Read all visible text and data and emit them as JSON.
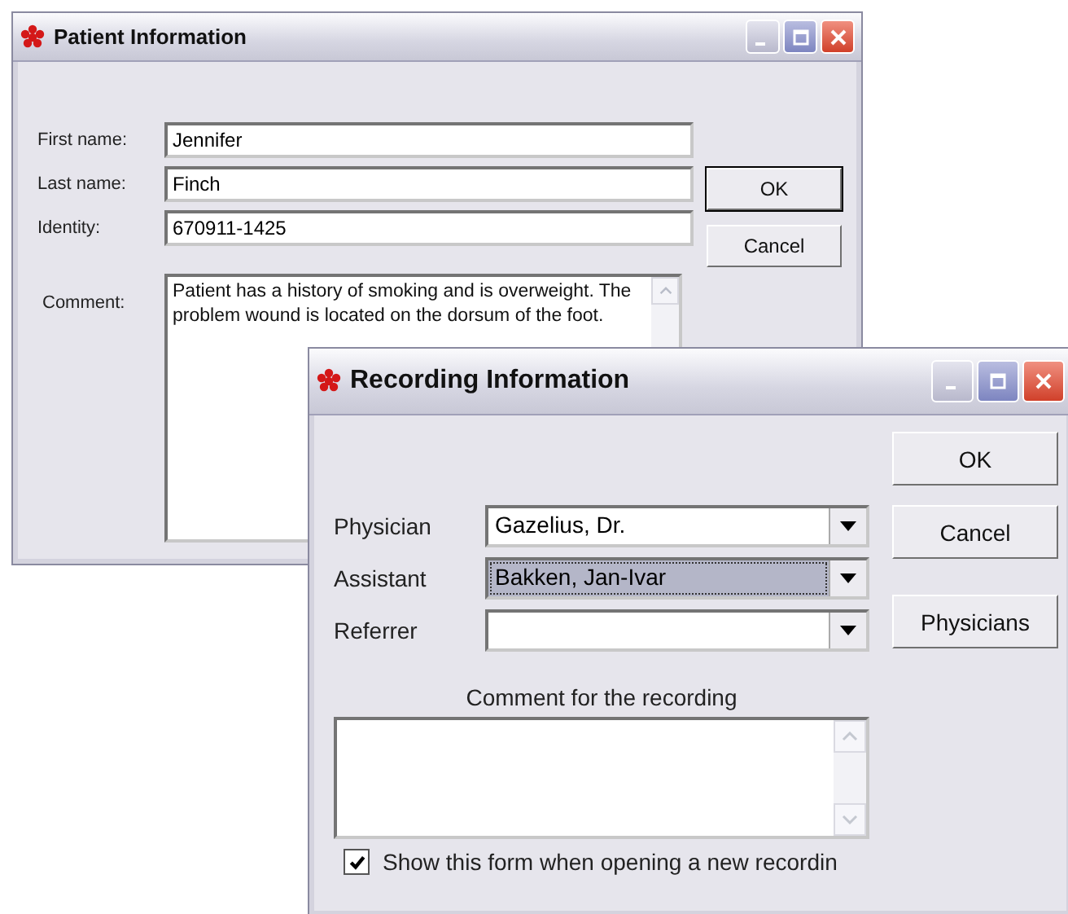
{
  "patient_window": {
    "title": "Patient Information",
    "fields": [
      {
        "label": "First name:",
        "value": "Jennifer"
      },
      {
        "label": "Last name:",
        "value": "Finch"
      },
      {
        "label": "Identity:",
        "value": "670911-1425"
      }
    ],
    "comment": {
      "label": "Comment:",
      "value": "Patient has a history of smoking and is overweight. The problem wound is located on the dorsum of the foot."
    },
    "buttons": [
      {
        "label": "OK",
        "default": true
      },
      {
        "label": "Cancel",
        "default": false
      }
    ]
  },
  "recording_window": {
    "title": "Recording Information",
    "dropdowns": [
      {
        "label": "Physician",
        "value": "Gazelius, Dr.",
        "selected": false
      },
      {
        "label": "Assistant",
        "value": "Bakken, Jan-Ivar",
        "selected": true
      },
      {
        "label": "Referrer",
        "selected": false
      }
    ],
    "comment_label": "Comment for the recording",
    "checkbox": {
      "label": "Show this form when opening a new recordin",
      "checked": true
    },
    "buttons": [
      {
        "label": "OK"
      },
      {
        "label": "Cancel"
      },
      {
        "label": "Physicians"
      }
    ]
  }
}
